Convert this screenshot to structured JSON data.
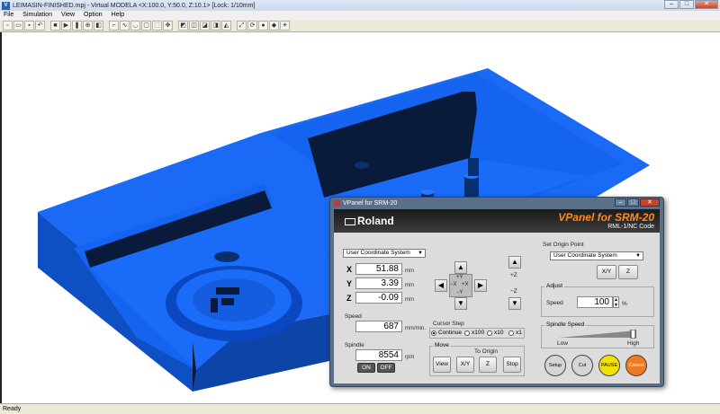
{
  "window": {
    "title": "LEIMASIN-FINISHED.mpj - Virtual MODELA <X:100.0, Y:50.0, Z:10.1> [Lock: 1/10mm]",
    "min": "–",
    "max": "□",
    "close": "✕"
  },
  "menu": [
    "File",
    "Simulation",
    "View",
    "Option",
    "Help"
  ],
  "toolbar_icons": [
    "new-icon",
    "open-icon",
    "save-icon",
    "undo-icon",
    "stop-icon",
    "play-icon",
    "pause-icon",
    "zoom-icon",
    "view-icon",
    "tool-icon",
    "path-icon",
    "curve-icon",
    "shape-icon",
    "select-icon",
    "move-icon",
    "render-icon",
    "mode-icon",
    "mode2-icon",
    "mode3-icon",
    "mode4-icon",
    "fit-icon",
    "rotate-icon",
    "sphere-icon",
    "color-icon",
    "light-icon"
  ],
  "status": "Ready",
  "vpanel": {
    "title": "VPanel for SRM-20",
    "min": "–",
    "max": "□",
    "close": "✕",
    "brand_logo": "Roland",
    "product": "VPanel for SRM-20",
    "subtitle": "RML-1/NC Code",
    "coord_system": "User Coordinate System",
    "x_label": "X",
    "x_value": "51.88",
    "y_label": "Y",
    "y_value": "3.39",
    "z_label": "Z",
    "z_value": "-0.09",
    "unit_mm": "mm",
    "speed_label": "Speed",
    "speed_value": "687",
    "speed_unit": "mm/min.",
    "spindle_label": "Spindle",
    "spindle_value": "8554",
    "spindle_unit": "rpm",
    "on_label": "ON",
    "off_label": "OFF",
    "jog": {
      "up": "▲",
      "down": "▼",
      "left": "◀",
      "right": "▶",
      "plus_y": "+Y",
      "minus_y": "−Y",
      "minus_x": "−X",
      "plus_x": "+X",
      "plus_z": "+Z",
      "minus_z": "−Z"
    },
    "cursor_step_label": "Cursor Step",
    "cursor_steps": [
      "Continue",
      "x100",
      "x10",
      "x1"
    ],
    "move_label": "Move",
    "to_origin_label": "To Origin",
    "view_btn": "View",
    "xy_btn": "X/Y",
    "z_btn": "Z",
    "stop_btn": "Stop",
    "set_origin_label": "Set Origin Point",
    "origin_coord": "User Coordinate System",
    "origin_xy": "X/Y",
    "origin_z": "Z",
    "adjust_label": "Adjust",
    "adjust_speed_label": "Speed",
    "adjust_speed_value": "100",
    "percent": "%",
    "spindle_speed_label": "Spindle Speed",
    "low_label": "Low",
    "high_label": "High",
    "spindle_speed_level": 0.95,
    "setup_btn": "Setup",
    "cut_btn": "Cut",
    "pause_btn": "PAUSE",
    "cancel_btn": "Cancel"
  },
  "colors": {
    "model_blue": "#1464f0",
    "model_dark": "#0a2a6a",
    "pause": "#f2e000",
    "cancel": "#f07a20"
  }
}
